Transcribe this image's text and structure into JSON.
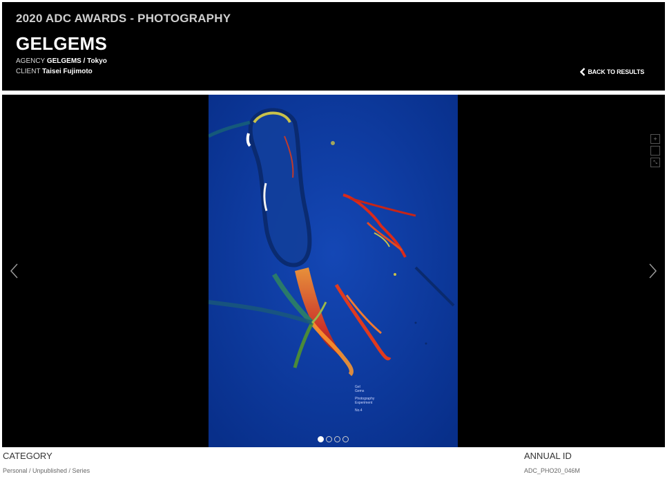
{
  "header": {
    "award_title": "2020 ADC AWARDS - PHOTOGRAPHY",
    "entry_title": "GELGEMS",
    "agency_label": "AGENCY",
    "agency_value": "GELGEMS / Tokyo",
    "client_label": "CLIENT",
    "client_value": "Taisei Fujimoto",
    "back_label": "BACK TO RESULTS"
  },
  "viewer": {
    "poster_line1": "Gel",
    "poster_line2": "Gems",
    "poster_line3": "Photography",
    "poster_line4": "Experiment",
    "poster_number": "No.4",
    "tools": {
      "zoom_in_symbol": "+",
      "fullscreen_symbol": "",
      "shrink_symbol": "⤡"
    },
    "slides": [
      {
        "active": true
      },
      {
        "active": false
      },
      {
        "active": false
      },
      {
        "active": false
      }
    ]
  },
  "info": {
    "category_label": "CATEGORY",
    "category_value": "Personal / Unpublished / Series",
    "annual_id_label": "ANNUAL ID",
    "annual_id_value": "ADC_PHO20_046M"
  },
  "colors": {
    "header_bg": "#000000",
    "photo_blue": "#0b3aa0",
    "accent_red": "#d92a1a"
  }
}
